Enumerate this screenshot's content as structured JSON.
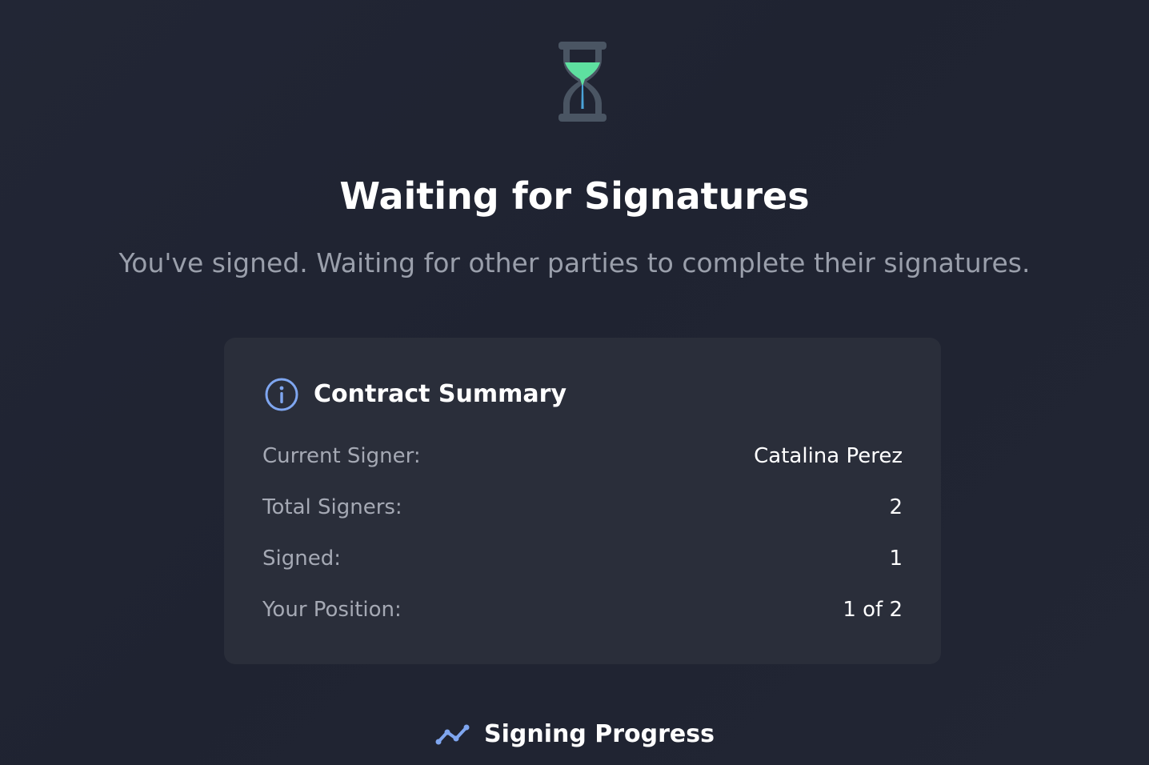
{
  "header": {
    "icon": "hourglass-icon",
    "title": "Waiting for Signatures",
    "subtitle": "You've signed. Waiting for other parties to complete their signatures."
  },
  "summary": {
    "icon": "info-icon",
    "title": "Contract Summary",
    "rows": [
      {
        "label": "Current Signer:",
        "value": "Catalina Perez"
      },
      {
        "label": "Total Signers:",
        "value": "2"
      },
      {
        "label": "Signed:",
        "value": "1"
      },
      {
        "label": "Your Position:",
        "value": "1 of 2"
      }
    ]
  },
  "progress": {
    "icon": "trend-line-icon",
    "title": "Signing Progress"
  },
  "colors": {
    "background": "#1f2330",
    "card": "#2a2e3a",
    "accent_green": "#5ee0a0",
    "accent_blue": "#7fa6f0",
    "muted_text": "#9a9fab"
  }
}
